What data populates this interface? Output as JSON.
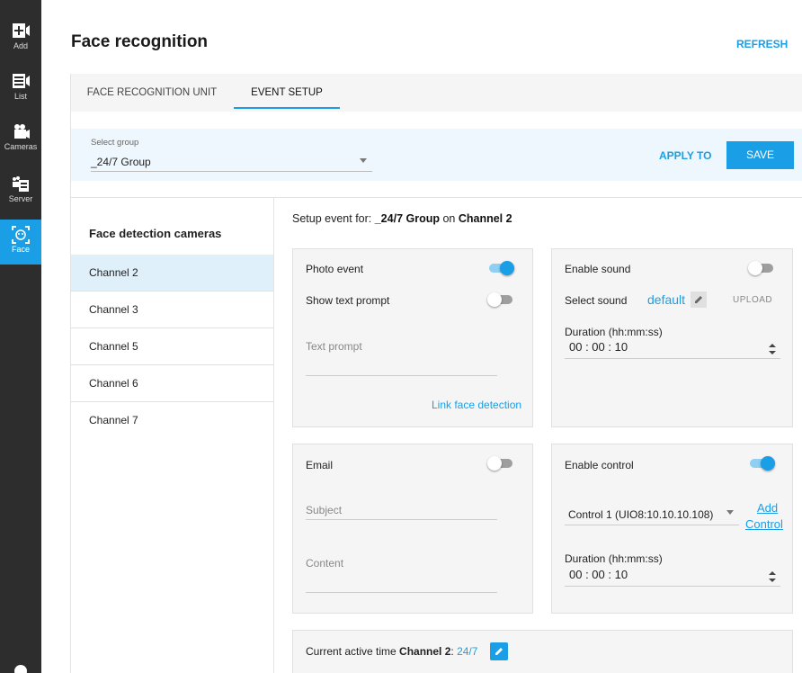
{
  "sidebar": {
    "items": [
      {
        "label": "Add",
        "icon": "add-camera-icon"
      },
      {
        "label": "List",
        "icon": "list-icon"
      },
      {
        "label": "Cameras",
        "icon": "cameras-icon"
      },
      {
        "label": "Server",
        "icon": "server-icon"
      },
      {
        "label": "Face",
        "icon": "face-icon"
      }
    ]
  },
  "header": {
    "title": "Face recognition",
    "refresh_label": "REFRESH"
  },
  "tabs": [
    {
      "label": "FACE RECOGNITION UNIT"
    },
    {
      "label": "EVENT SETUP",
      "active": true
    }
  ],
  "group": {
    "label": "Select group",
    "value": "_24/7 Group",
    "apply_label": "APPLY TO",
    "save_label": "SAVE"
  },
  "cameras": {
    "title": "Face detection cameras",
    "items": [
      "Channel 2",
      "Channel 3",
      "Channel 5",
      "Channel 6",
      "Channel 7"
    ],
    "selected": "Channel 2"
  },
  "setup": {
    "prefix": "Setup event for: ",
    "group": "_24/7 Group",
    "mid": " on ",
    "channel": "Channel 2"
  },
  "photo_card": {
    "photo_label": "Photo event",
    "photo_on": true,
    "prompt_label": "Show text prompt",
    "prompt_on": false,
    "text_placeholder": "Text prompt",
    "link_label": "Link face detection"
  },
  "sound_card": {
    "enable_label": "Enable sound",
    "enable_on": false,
    "select_label": "Select sound",
    "sound_value": "default",
    "upload_label": "UPLOAD",
    "duration_label": "Duration (hh:mm:ss)",
    "duration_value": "00 : 00 : 10"
  },
  "email_card": {
    "label": "Email",
    "on": false,
    "subject_placeholder": "Subject",
    "content_placeholder": "Content"
  },
  "control_card": {
    "enable_label": "Enable control",
    "enable_on": true,
    "control_value": "Control 1 (UIO8:10.10.10.108)",
    "add_label_1": "Add",
    "add_label_2": "Control",
    "duration_label": "Duration (hh:mm:ss)",
    "duration_value": "00 : 00 : 10"
  },
  "active_time": {
    "prefix": "Current active time ",
    "channel": "Channel 2",
    "colon": ": ",
    "value": "24/7"
  },
  "colors": {
    "accent": "#1a9ee6",
    "sidebar": "#2d2d2d",
    "selected_row": "#dff0fb"
  }
}
